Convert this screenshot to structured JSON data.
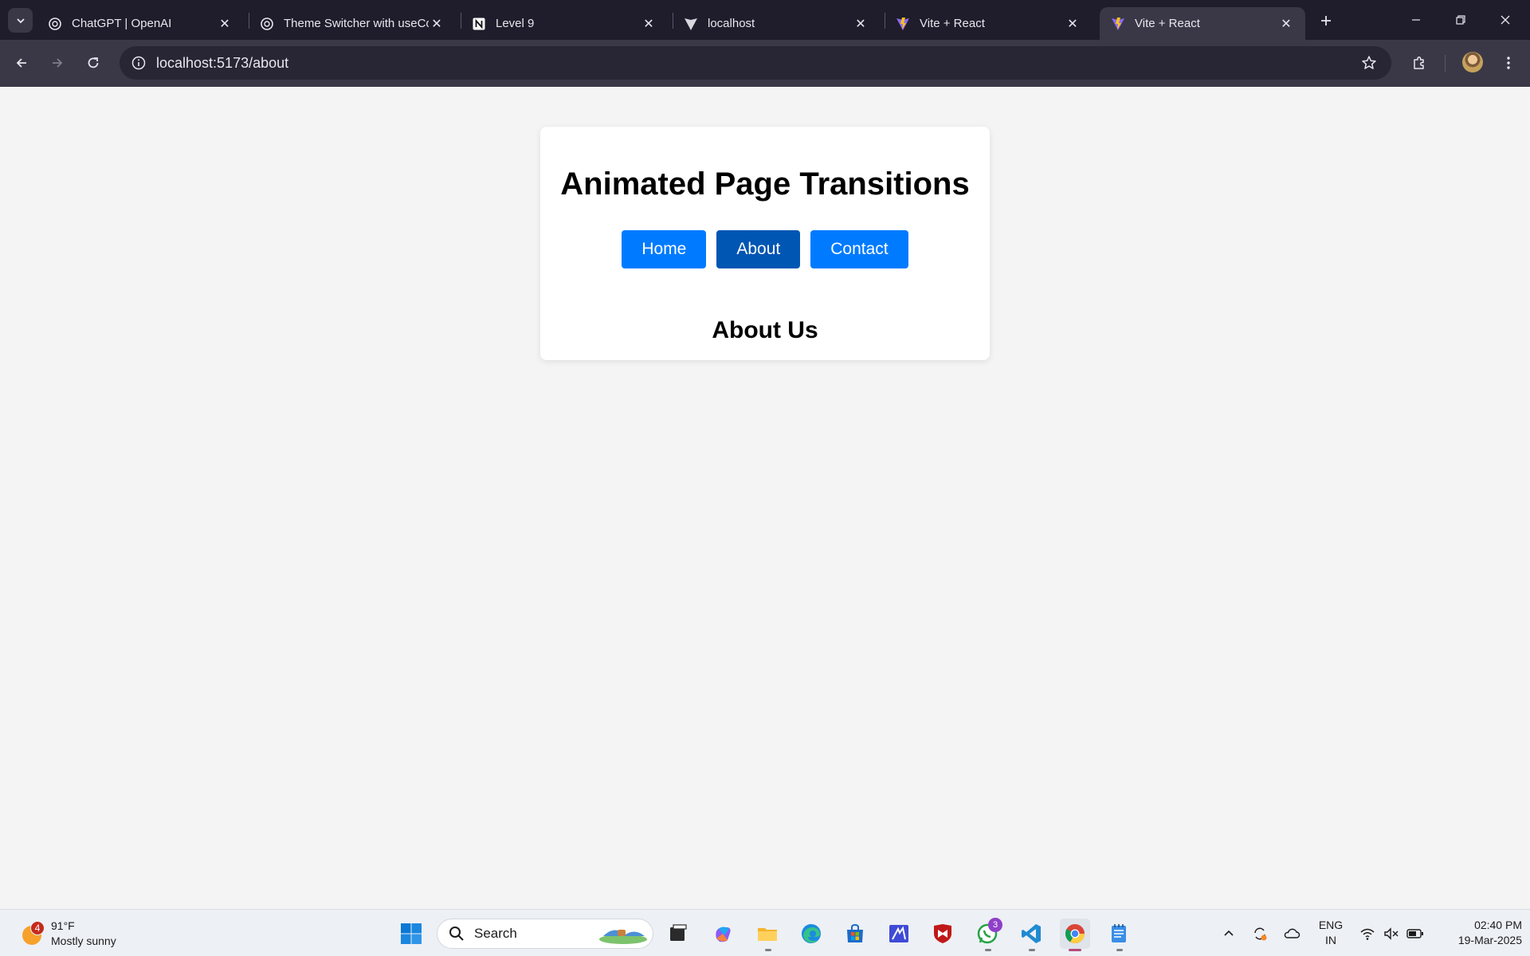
{
  "browser": {
    "tabs": [
      {
        "title": "ChatGPT | OpenAI",
        "icon": "openai-icon",
        "active": false
      },
      {
        "title": "Theme Switcher with useContext",
        "icon": "openai-icon",
        "active": false
      },
      {
        "title": "Level 9",
        "icon": "notion-icon",
        "active": false
      },
      {
        "title": "localhost",
        "icon": "vite-icon",
        "active": false
      },
      {
        "title": "Vite + React",
        "icon": "vite-icon",
        "active": false
      },
      {
        "title": "Vite + React",
        "icon": "vite-icon",
        "active": true
      }
    ],
    "url": "localhost:5173/about"
  },
  "page": {
    "title": "Animated Page Transitions",
    "nav": [
      {
        "label": "Home",
        "active": false
      },
      {
        "label": "About",
        "active": true
      },
      {
        "label": "Contact",
        "active": false
      }
    ],
    "section_heading": "About Us",
    "colors": {
      "button": "#007bff",
      "button_active": "#0056b3",
      "background": "#f4f4f4",
      "card": "#ffffff"
    }
  },
  "taskbar": {
    "weather": {
      "badge": "4",
      "temp": "91°F",
      "condition": "Mostly sunny"
    },
    "search_label": "Search",
    "whatsapp_badge": "3",
    "language": {
      "line1": "ENG",
      "line2": "IN"
    },
    "clock": {
      "time": "02:40 PM",
      "date": "19-Mar-2025"
    }
  }
}
